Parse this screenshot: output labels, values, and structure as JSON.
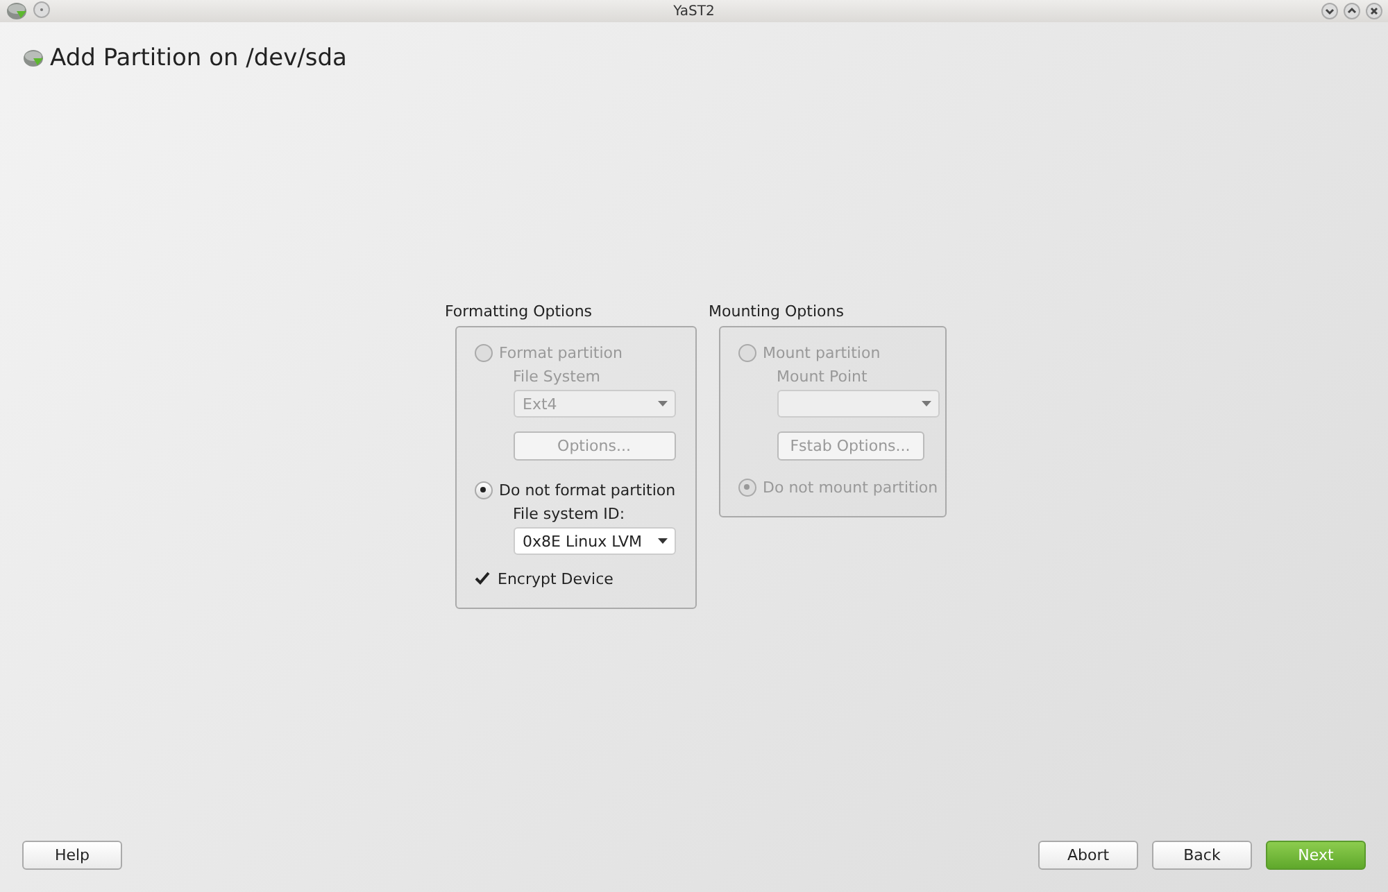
{
  "window": {
    "title": "YaST2"
  },
  "heading": "Add Partition on /dev/sda",
  "formatting": {
    "title": "Formatting Options",
    "format_radio": {
      "label": "Format partition",
      "selected": false,
      "disabled": true
    },
    "file_system": {
      "label": "File System",
      "value": "Ext4",
      "disabled": true
    },
    "options_button": {
      "label": "Options...",
      "disabled": true
    },
    "no_format_radio": {
      "label": "Do not format partition",
      "selected": true,
      "disabled": false
    },
    "file_system_id": {
      "label": "File system ID:",
      "value": "0x8E Linux LVM",
      "disabled": false
    },
    "encrypt": {
      "label": "Encrypt Device",
      "checked": true
    }
  },
  "mounting": {
    "title": "Mounting Options",
    "mount_radio": {
      "label": "Mount partition",
      "selected": false,
      "disabled": true
    },
    "mount_point": {
      "label": "Mount Point",
      "disabled": true
    },
    "fstab_button": {
      "label": "Fstab Options...",
      "disabled": true
    },
    "no_mount_radio": {
      "label": "Do not mount partition",
      "selected": true,
      "disabled": true
    }
  },
  "buttons": [
    {
      "label": "Help",
      "kind": "plain"
    },
    {
      "label": "Abort",
      "kind": "plain"
    },
    {
      "label": "Back",
      "kind": "plain"
    },
    {
      "label": "Next",
      "kind": "primary"
    }
  ]
}
